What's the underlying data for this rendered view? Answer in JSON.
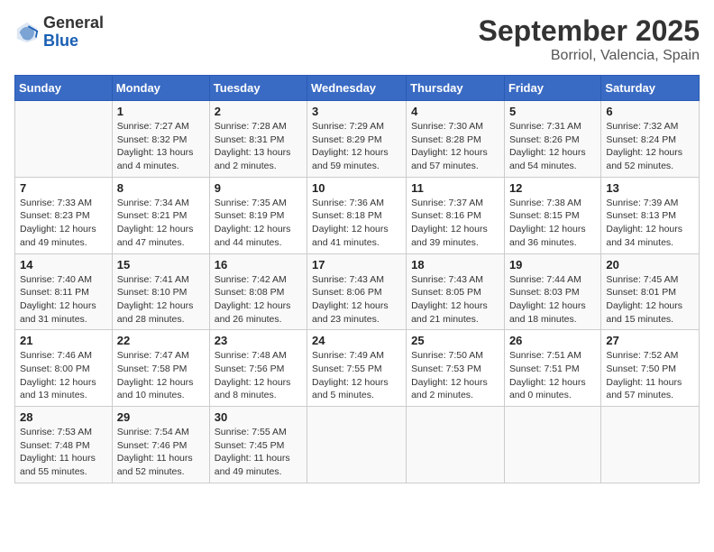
{
  "header": {
    "logo_general": "General",
    "logo_blue": "Blue",
    "month_title": "September 2025",
    "location": "Borriol, Valencia, Spain"
  },
  "days_of_week": [
    "Sunday",
    "Monday",
    "Tuesday",
    "Wednesday",
    "Thursday",
    "Friday",
    "Saturday"
  ],
  "weeks": [
    [
      {
        "day": "",
        "info": ""
      },
      {
        "day": "1",
        "info": "Sunrise: 7:27 AM\nSunset: 8:32 PM\nDaylight: 13 hours\nand 4 minutes."
      },
      {
        "day": "2",
        "info": "Sunrise: 7:28 AM\nSunset: 8:31 PM\nDaylight: 13 hours\nand 2 minutes."
      },
      {
        "day": "3",
        "info": "Sunrise: 7:29 AM\nSunset: 8:29 PM\nDaylight: 12 hours\nand 59 minutes."
      },
      {
        "day": "4",
        "info": "Sunrise: 7:30 AM\nSunset: 8:28 PM\nDaylight: 12 hours\nand 57 minutes."
      },
      {
        "day": "5",
        "info": "Sunrise: 7:31 AM\nSunset: 8:26 PM\nDaylight: 12 hours\nand 54 minutes."
      },
      {
        "day": "6",
        "info": "Sunrise: 7:32 AM\nSunset: 8:24 PM\nDaylight: 12 hours\nand 52 minutes."
      }
    ],
    [
      {
        "day": "7",
        "info": "Sunrise: 7:33 AM\nSunset: 8:23 PM\nDaylight: 12 hours\nand 49 minutes."
      },
      {
        "day": "8",
        "info": "Sunrise: 7:34 AM\nSunset: 8:21 PM\nDaylight: 12 hours\nand 47 minutes."
      },
      {
        "day": "9",
        "info": "Sunrise: 7:35 AM\nSunset: 8:19 PM\nDaylight: 12 hours\nand 44 minutes."
      },
      {
        "day": "10",
        "info": "Sunrise: 7:36 AM\nSunset: 8:18 PM\nDaylight: 12 hours\nand 41 minutes."
      },
      {
        "day": "11",
        "info": "Sunrise: 7:37 AM\nSunset: 8:16 PM\nDaylight: 12 hours\nand 39 minutes."
      },
      {
        "day": "12",
        "info": "Sunrise: 7:38 AM\nSunset: 8:15 PM\nDaylight: 12 hours\nand 36 minutes."
      },
      {
        "day": "13",
        "info": "Sunrise: 7:39 AM\nSunset: 8:13 PM\nDaylight: 12 hours\nand 34 minutes."
      }
    ],
    [
      {
        "day": "14",
        "info": "Sunrise: 7:40 AM\nSunset: 8:11 PM\nDaylight: 12 hours\nand 31 minutes."
      },
      {
        "day": "15",
        "info": "Sunrise: 7:41 AM\nSunset: 8:10 PM\nDaylight: 12 hours\nand 28 minutes."
      },
      {
        "day": "16",
        "info": "Sunrise: 7:42 AM\nSunset: 8:08 PM\nDaylight: 12 hours\nand 26 minutes."
      },
      {
        "day": "17",
        "info": "Sunrise: 7:43 AM\nSunset: 8:06 PM\nDaylight: 12 hours\nand 23 minutes."
      },
      {
        "day": "18",
        "info": "Sunrise: 7:43 AM\nSunset: 8:05 PM\nDaylight: 12 hours\nand 21 minutes."
      },
      {
        "day": "19",
        "info": "Sunrise: 7:44 AM\nSunset: 8:03 PM\nDaylight: 12 hours\nand 18 minutes."
      },
      {
        "day": "20",
        "info": "Sunrise: 7:45 AM\nSunset: 8:01 PM\nDaylight: 12 hours\nand 15 minutes."
      }
    ],
    [
      {
        "day": "21",
        "info": "Sunrise: 7:46 AM\nSunset: 8:00 PM\nDaylight: 12 hours\nand 13 minutes."
      },
      {
        "day": "22",
        "info": "Sunrise: 7:47 AM\nSunset: 7:58 PM\nDaylight: 12 hours\nand 10 minutes."
      },
      {
        "day": "23",
        "info": "Sunrise: 7:48 AM\nSunset: 7:56 PM\nDaylight: 12 hours\nand 8 minutes."
      },
      {
        "day": "24",
        "info": "Sunrise: 7:49 AM\nSunset: 7:55 PM\nDaylight: 12 hours\nand 5 minutes."
      },
      {
        "day": "25",
        "info": "Sunrise: 7:50 AM\nSunset: 7:53 PM\nDaylight: 12 hours\nand 2 minutes."
      },
      {
        "day": "26",
        "info": "Sunrise: 7:51 AM\nSunset: 7:51 PM\nDaylight: 12 hours\nand 0 minutes."
      },
      {
        "day": "27",
        "info": "Sunrise: 7:52 AM\nSunset: 7:50 PM\nDaylight: 11 hours\nand 57 minutes."
      }
    ],
    [
      {
        "day": "28",
        "info": "Sunrise: 7:53 AM\nSunset: 7:48 PM\nDaylight: 11 hours\nand 55 minutes."
      },
      {
        "day": "29",
        "info": "Sunrise: 7:54 AM\nSunset: 7:46 PM\nDaylight: 11 hours\nand 52 minutes."
      },
      {
        "day": "30",
        "info": "Sunrise: 7:55 AM\nSunset: 7:45 PM\nDaylight: 11 hours\nand 49 minutes."
      },
      {
        "day": "",
        "info": ""
      },
      {
        "day": "",
        "info": ""
      },
      {
        "day": "",
        "info": ""
      },
      {
        "day": "",
        "info": ""
      }
    ]
  ]
}
